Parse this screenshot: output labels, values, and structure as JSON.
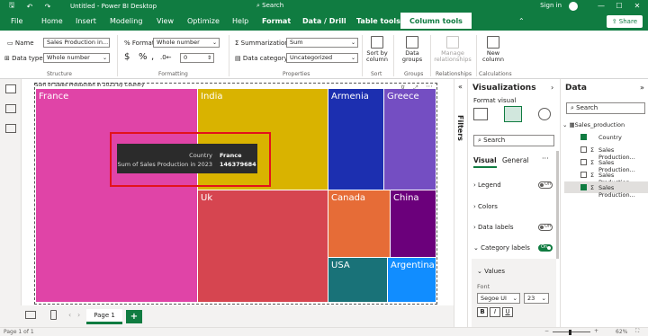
{
  "titlebar": {
    "title": "Untitled - Power BI Desktop",
    "sign_in": "Sign in",
    "minimize": "—",
    "maximize": "☐",
    "close": "✕"
  },
  "menu": {
    "items": [
      "File",
      "Home",
      "Insert",
      "Modeling",
      "View",
      "Optimize",
      "Help",
      "Format",
      "Data / Drill",
      "Table tools",
      "Column tools"
    ],
    "search_placeholder": "Search",
    "share": "Share"
  },
  "ribbon": {
    "structure": {
      "name_label": "Name",
      "name_value": "Sales Production in...",
      "datatype_label": "Data type",
      "datatype_value": "Whole number",
      "group": "Structure"
    },
    "formatting": {
      "format_label": "Format",
      "format_value": "Whole number",
      "currency": "$",
      "percent": "%",
      "comma": ",",
      "decimals": "0",
      "group": "Formatting"
    },
    "properties": {
      "summarization_label": "Summarization",
      "summarization_value": "Sum",
      "datacategory_label": "Data category",
      "datacategory_value": "Uncategorized",
      "group": "Properties"
    },
    "sort": {
      "label1": "Sort by",
      "label2": "column",
      "group": "Sort"
    },
    "groups": {
      "label1": "Data",
      "label2": "groups",
      "group": "Groups"
    },
    "relationships": {
      "label1": "Manage",
      "label2": "relationships",
      "group": "Relationships"
    },
    "calculations": {
      "label1": "New",
      "label2": "column",
      "group": "Calculations"
    }
  },
  "visual": {
    "title": "Sum of Sales Production in 2023 by Country"
  },
  "chart_data": {
    "type": "treemap",
    "title": "Sum of Sales Production in 2023 by Country",
    "categories": [
      "France",
      "India",
      "Uk",
      "Armenia",
      "Greece",
      "Canada",
      "China",
      "USA",
      "Argentina"
    ],
    "colors": [
      "#e044a7",
      "#d9b300",
      "#d64550",
      "#1c2fb0",
      "#744ec2",
      "#e66c37",
      "#6b007b",
      "#197278",
      "#118dff"
    ]
  },
  "tooltip": {
    "k1": "Country",
    "v1": "France",
    "k2": "Sum of Sales Production in 2023",
    "v2": "146379684"
  },
  "filters": {
    "label": "Filters"
  },
  "viz_pane": {
    "title": "Visualizations",
    "format_visual": "Format visual",
    "search_placeholder": "Search",
    "tab_visual": "Visual",
    "tab_general": "General",
    "more": "···",
    "sections": [
      {
        "label": "Legend",
        "toggle": "Off"
      },
      {
        "label": "Colors"
      },
      {
        "label": "Data labels",
        "toggle": "Off"
      },
      {
        "label": "Category labels",
        "toggle": "On"
      }
    ],
    "values_label": "Values",
    "font_label": "Font",
    "font_family": "Segoe UI",
    "font_size": "23",
    "bold": "B",
    "italic": "I",
    "underline": "U"
  },
  "data_pane": {
    "title": "Data",
    "search_placeholder": "Search",
    "table": "Sales_production",
    "fields": [
      {
        "label": "Country",
        "checked": true,
        "sigma": false
      },
      {
        "label": "Sales Production...",
        "checked": false,
        "sigma": true
      },
      {
        "label": "Sales Production...",
        "checked": false,
        "sigma": true
      },
      {
        "label": "Sales Production...",
        "checked": false,
        "sigma": true
      },
      {
        "label": "Sales Production...",
        "checked": true,
        "sigma": true
      }
    ]
  },
  "pages": {
    "tab": "Page 1",
    "add": "+"
  },
  "status": {
    "page": "Page 1 of 1",
    "zoom": "62%"
  }
}
